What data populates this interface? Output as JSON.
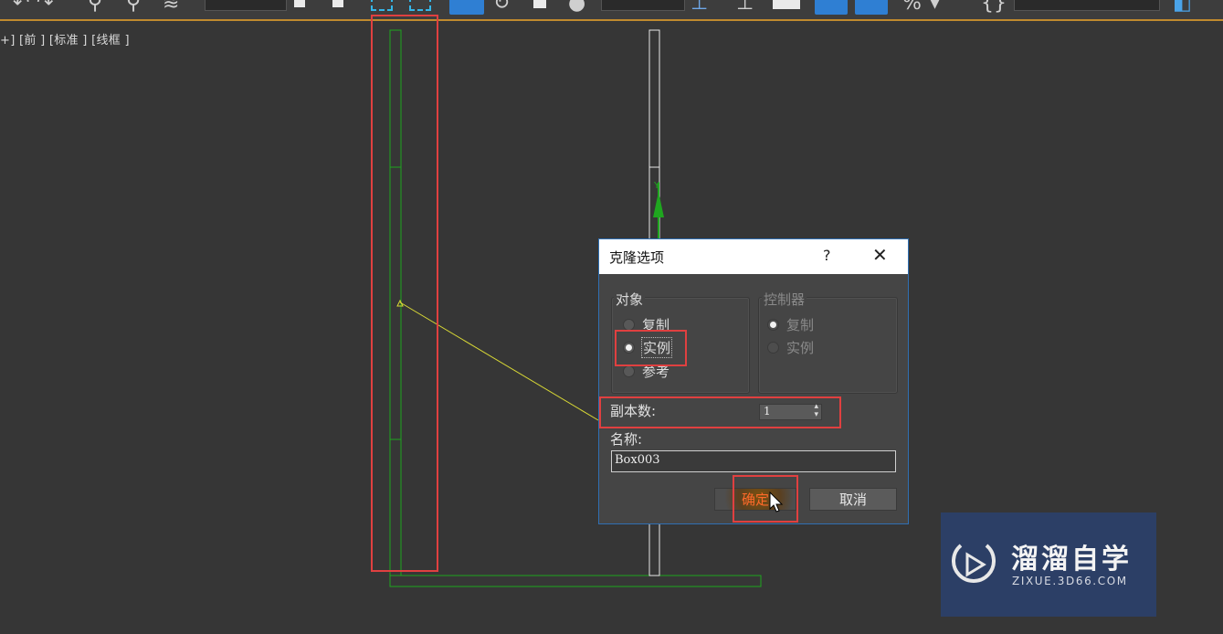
{
  "viewport": {
    "label": "+] [前 ] [标准 ] [线框 ]"
  },
  "toolbar": {
    "icons": [
      "undo-icon",
      "redo-icon",
      "link-icon",
      "unlink-icon",
      "bind-space-warp-icon",
      "selection-filter-dropdown",
      "select-object-icon",
      "select-by-name-icon",
      "rect-selection-icon",
      "window-crossing-icon",
      "select-move-icon",
      "select-rotate-icon",
      "select-scale-icon",
      "coord-system-dropdown",
      "pivot-icon",
      "snap-toggle-icon",
      "angle-snap-icon",
      "percent-snap-icon",
      "named-selection-dropdown"
    ]
  },
  "dialog": {
    "title": "克隆选项",
    "help": "?",
    "close": "✕",
    "object_group": {
      "label": "对象",
      "options": [
        "复制",
        "实例",
        "参考"
      ],
      "selected": "实例"
    },
    "controller_group": {
      "label": "控制器",
      "options": [
        "复制",
        "实例"
      ],
      "selected": "复制"
    },
    "copies_label": "副本数:",
    "copies_value": "1",
    "name_label": "名称:",
    "name_value": "Box003",
    "ok_label": "确定",
    "cancel_label": "取消"
  },
  "watermark": {
    "title": "溜溜自学",
    "subtitle": "ZIXUE.3D66.COM"
  },
  "colors": {
    "viewport_bg": "#363636",
    "selection_green": "#1fa61f",
    "highlight_red": "#e04040",
    "dialog_border": "#2f6fb3",
    "ok_text": "#ff6a2a",
    "watermark_bg": "#2c3f66"
  }
}
